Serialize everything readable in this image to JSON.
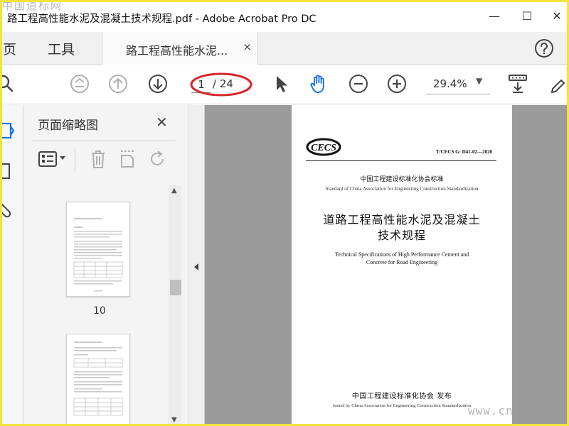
{
  "window": {
    "title": "路工程高性能水泥及混凝土技术规程.pdf - Adobe Acrobat Pro DC",
    "watermark_top": "中国道标网",
    "minimize": "—",
    "maximize": "☐",
    "close": "✕"
  },
  "tabs": {
    "home": "主页",
    "tools": "工具",
    "document": "路工程高性能水泥...",
    "document_close": "×"
  },
  "toolbar": {
    "current_page": "1",
    "total_pages": "/ 24",
    "zoom": "29.4%",
    "zoom_caret": "▼"
  },
  "thumb_panel": {
    "title": "页面缩略图",
    "close": "✕",
    "thumbnail_label": "10",
    "scroll_up": "▲",
    "scroll_down": "▼"
  },
  "document": {
    "logo_text": "CECS",
    "standard_number": "T/CECS G: D41-02—2020",
    "association_cn": "中国工程建设标准化协会标准",
    "association_en": "Standard of China Association for Engineering Construction Standardization",
    "title_cn_line1": "道路工程高性能水泥及混凝土",
    "title_cn_line2": "技术规程",
    "title_en_line1": "Technical Specifications of  High Performance Cement and",
    "title_en_line2": "Concrete for Road Engineering",
    "publisher_cn": "中国工程建设标准化协会    发布",
    "publisher_en": "Issued by China Association for Engineering Construction Standardization"
  },
  "watermark_bottom": "www.cn",
  "colors": {
    "frame": "#f2e43a",
    "hand_tool_active": "#1473e6",
    "annotation_red": "#d8242a",
    "viewer_bg": "#9b9b9b"
  }
}
